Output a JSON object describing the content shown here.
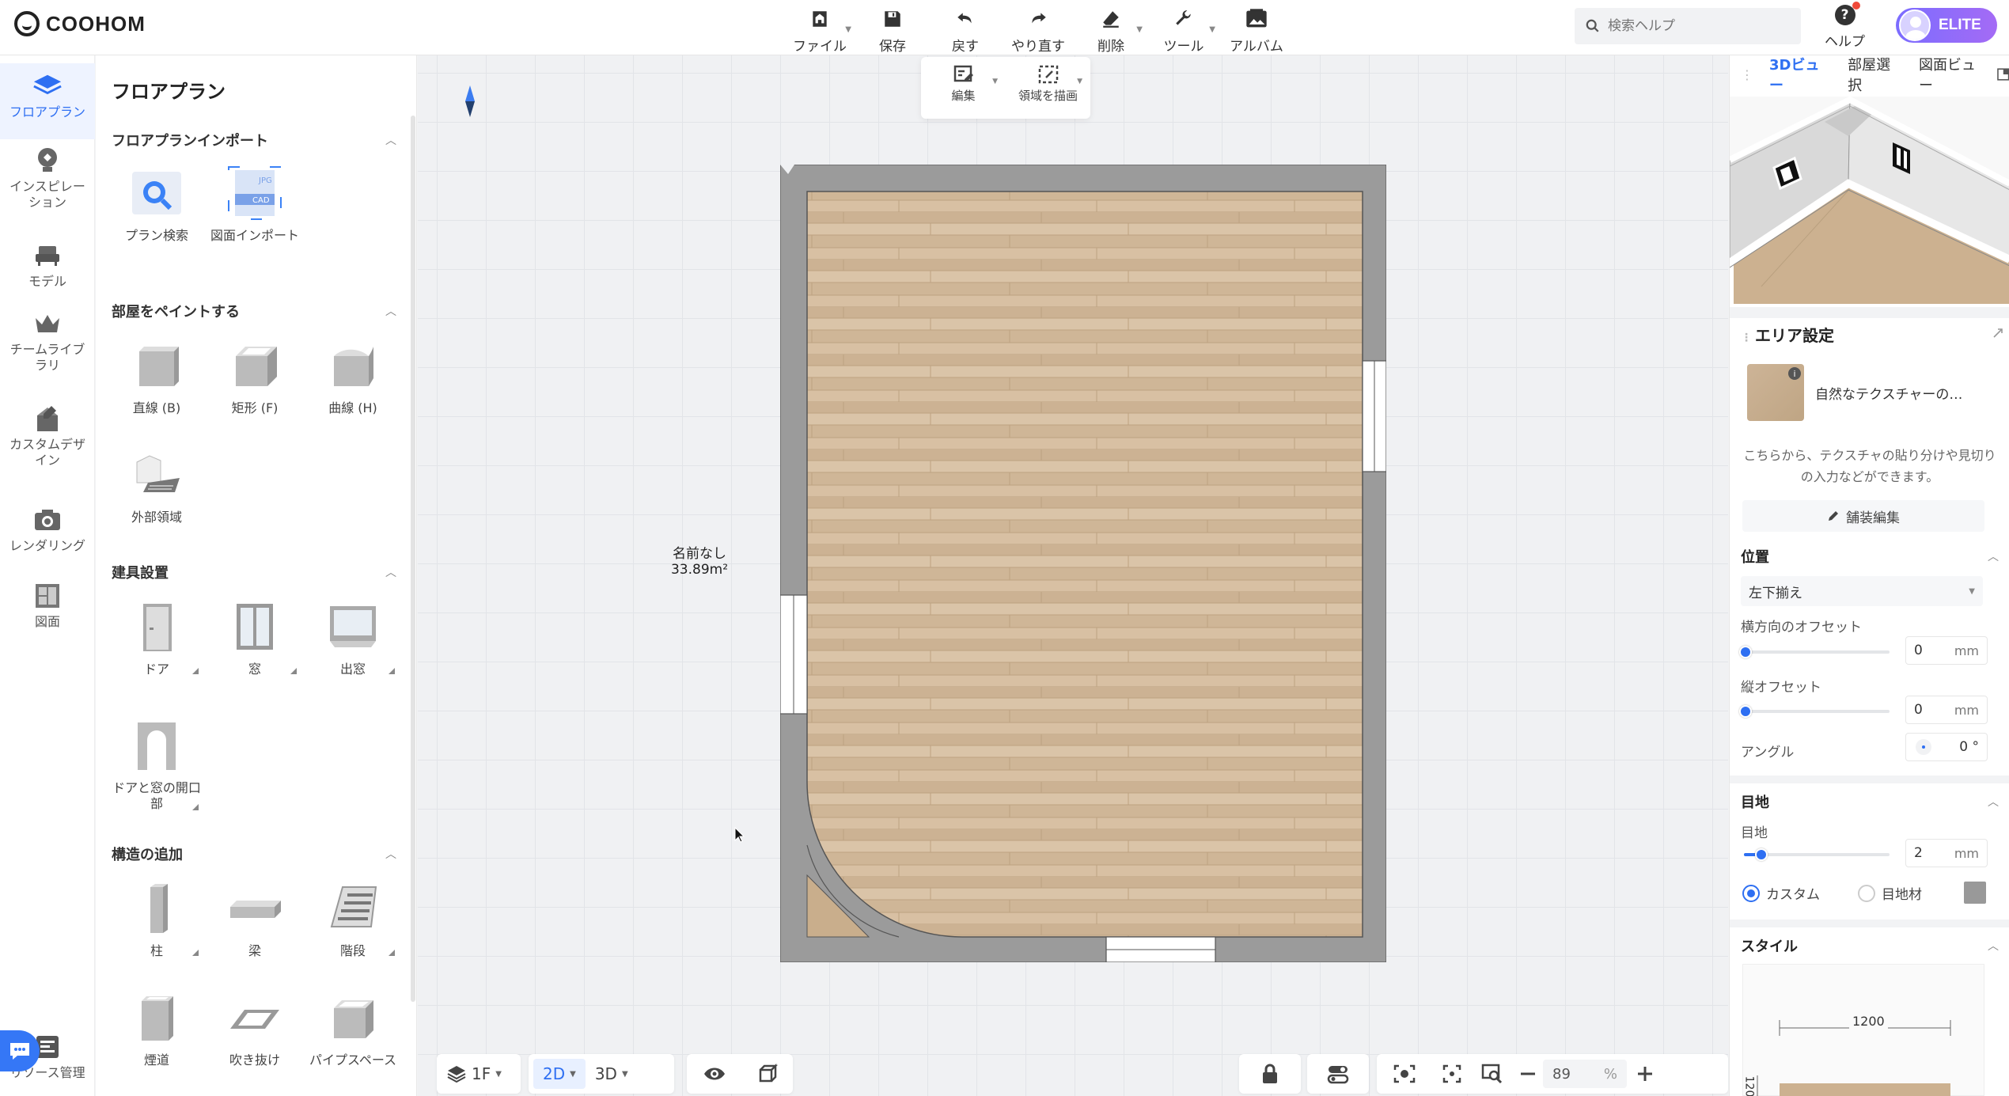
{
  "app": {
    "logo": "COOHOM"
  },
  "toolbar": {
    "items": [
      {
        "label": "ファイル",
        "icon": "home-icon",
        "caret": true
      },
      {
        "label": "保存",
        "icon": "save-icon",
        "caret": false
      },
      {
        "label": "戻す",
        "icon": "undo-icon",
        "caret": false
      },
      {
        "label": "やり直す",
        "icon": "redo-icon",
        "caret": false
      },
      {
        "label": "削除",
        "icon": "eraser-icon",
        "caret": true
      },
      {
        "label": "ツール",
        "icon": "wrench-icon",
        "caret": true
      },
      {
        "label": "アルバム",
        "icon": "album-icon",
        "caret": false
      }
    ],
    "search_placeholder": "検索ヘルプ",
    "help_label": "ヘルプ",
    "elite_label": "ELITE"
  },
  "leftnav": {
    "items": [
      {
        "label": "フロアプラン",
        "icon": "floorplan-icon",
        "active": true
      },
      {
        "label": "インスピレーション",
        "icon": "lightbulb-icon"
      },
      {
        "label": "モデル",
        "icon": "sofa-icon"
      },
      {
        "label": "チームライブラリ",
        "icon": "crown-icon"
      },
      {
        "label": "カスタムデザイン",
        "icon": "custom-design-icon"
      },
      {
        "label": "レンダリング",
        "icon": "camera-icon"
      },
      {
        "label": "図面",
        "icon": "drawing-icon"
      }
    ],
    "resource": "リソース管理"
  },
  "leftpanel": {
    "title": "フロアプラン",
    "sections": [
      {
        "title": "フロアプランインポート",
        "items": [
          "プラン検索",
          "図面インポート"
        ]
      },
      {
        "title": "部屋をペイントする",
        "items": [
          "直線 (B)",
          "矩形 (F)",
          "曲線 (H)",
          "外部領域"
        ]
      },
      {
        "title": "建具設置",
        "items": [
          "ドア",
          "窓",
          "出窓",
          "ドアと窓の開口部"
        ]
      },
      {
        "title": "構造の追加",
        "items": [
          "柱",
          "梁",
          "階段",
          "煙道",
          "吹き抜け",
          "パイプスペース"
        ]
      }
    ],
    "import_badges": [
      "JPG",
      "CAD"
    ]
  },
  "canvas": {
    "subtools": [
      "編集",
      "領域を描画"
    ],
    "room_name": "名前なし",
    "room_area": "33.89m²",
    "floor": "1F",
    "mode_2d": "2D",
    "mode_3d": "3D",
    "zoom": "89",
    "zoom_unit": "%"
  },
  "rightpanel": {
    "view_tabs": [
      "3Dビュー",
      "部屋選択",
      "図面ビュー"
    ],
    "area_title": "エリア設定",
    "material_name": "自然なテクスチャーの…",
    "description": "こちらから、テクスチャの貼り分けや見切りの入力などができます。",
    "edit_button": "舗装編集",
    "position": {
      "title": "位置",
      "anchor": "左下揃え",
      "h_offset_label": "横方向のオフセット",
      "h_offset": "0",
      "v_offset_label": "縦オフセット",
      "v_offset": "0",
      "angle_label": "アングル",
      "angle": "0 °",
      "unit": "mm"
    },
    "joint": {
      "title": "目地",
      "label": "目地",
      "value": "2",
      "value_fraction": 0.12,
      "custom": "カスタム",
      "material": "目地材"
    },
    "style": {
      "title": "スタイル",
      "width": "1200",
      "side": "120"
    }
  }
}
